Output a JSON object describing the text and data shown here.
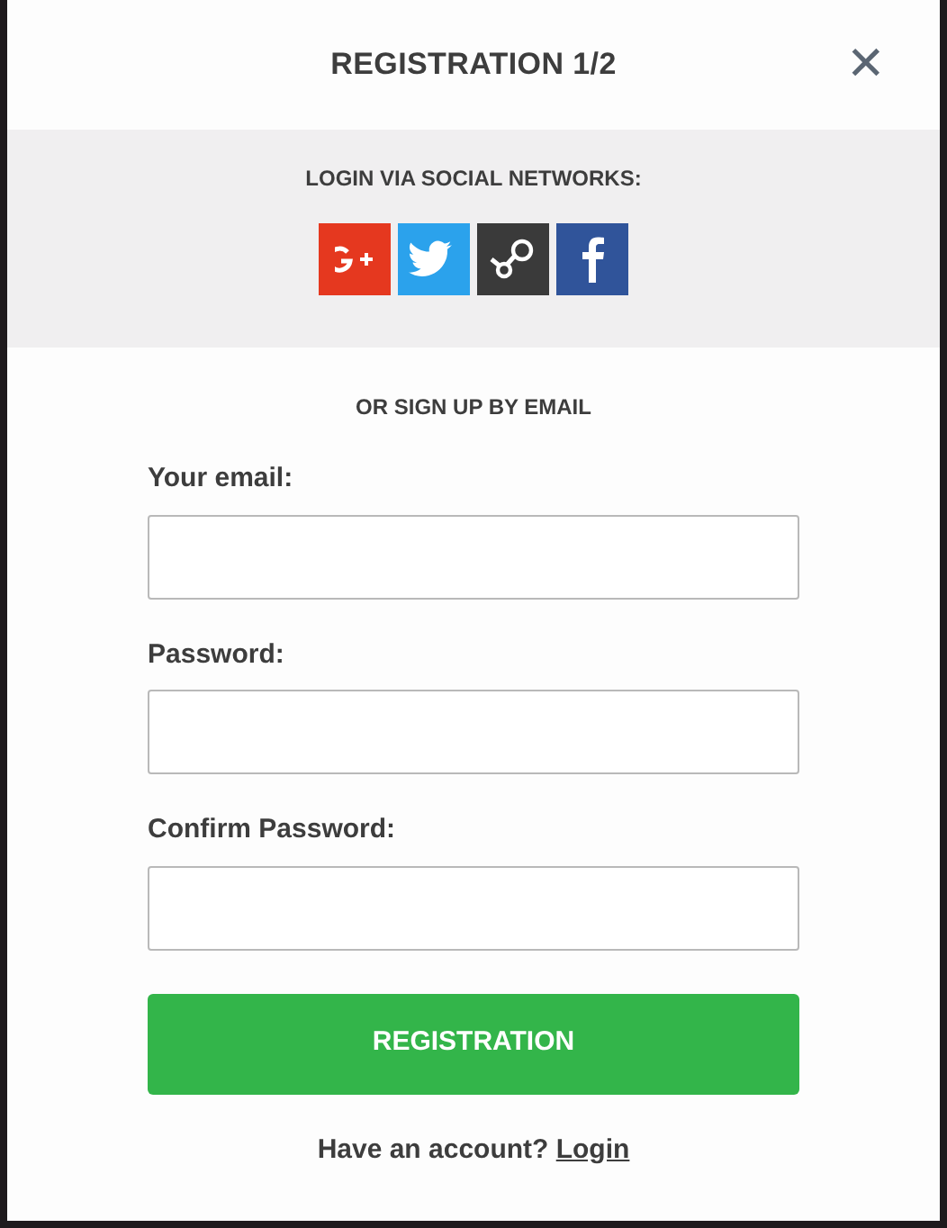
{
  "title": "REGISTRATION 1/2",
  "close": "✕",
  "social": {
    "heading": "LOGIN VIA SOCIAL NETWORKS:",
    "networks": [
      {
        "kind": "google"
      },
      {
        "kind": "twitter"
      },
      {
        "kind": "steam"
      },
      {
        "kind": "facebook"
      }
    ]
  },
  "divider_text": "OR SIGN UP BY EMAIL",
  "fields": [
    {
      "label": "Your email:"
    },
    {
      "label": "Password:"
    },
    {
      "label": "Confirm Password:"
    }
  ],
  "submit": "REGISTRATION",
  "footer": {
    "text": "Have an account?",
    "link": "Login"
  }
}
